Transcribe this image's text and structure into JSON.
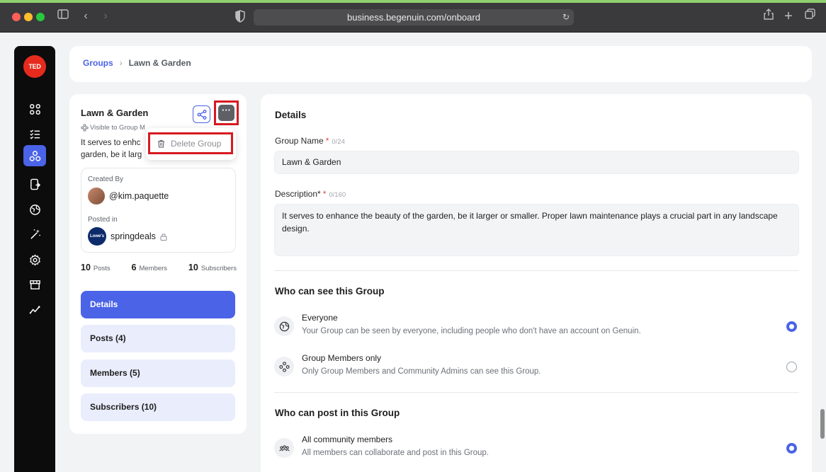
{
  "browser": {
    "url": "business.begenuin.com/onboard"
  },
  "sidebar": {
    "logo_text": "TED",
    "items": [
      {
        "icon": "grid-icon"
      },
      {
        "icon": "checklist-icon"
      },
      {
        "icon": "groups-icon",
        "active": true
      },
      {
        "icon": "mobile-share-icon"
      },
      {
        "icon": "globe-icon"
      },
      {
        "icon": "magic-wand-icon"
      },
      {
        "icon": "settings-icon"
      },
      {
        "icon": "store-icon"
      },
      {
        "icon": "analytics-icon"
      }
    ]
  },
  "breadcrumb": {
    "root": "Groups",
    "separator": "›",
    "current": "Lawn & Garden"
  },
  "group_card": {
    "title": "Lawn & Garden",
    "visibility_text": "Visible to Group M",
    "description_line1": "It serves to enhc",
    "description_line2": "garden, be it larg",
    "menu": {
      "delete_label": "Delete Group"
    },
    "created_by_label": "Created By",
    "creator": "@kim.paquette",
    "posted_in_label": "Posted in",
    "community": "springdeals",
    "brand_logo_text": "Lowe's",
    "stats": {
      "posts_count": "10",
      "posts_label": "Posts",
      "members_count": "6",
      "members_label": "Members",
      "subscribers_count": "10",
      "subscribers_label": "Subscribers"
    },
    "nav": {
      "details": "Details",
      "posts": "Posts (4)",
      "members": "Members (5)",
      "subscribers": "Subscribers (10)"
    }
  },
  "details": {
    "section_title": "Details",
    "group_name_label": "Group Name",
    "group_name_required": "*",
    "group_name_counter": "0/24",
    "group_name_value": "Lawn & Garden",
    "description_label": "Description*",
    "description_required": "*",
    "description_counter": "0/160",
    "description_value": "It serves to enhance the beauty of the garden, be it larger or smaller. Proper lawn maintenance plays a crucial part in any landscape design."
  },
  "visibility": {
    "section_title": "Who can see this Group",
    "options": [
      {
        "title": "Everyone",
        "description": "Your Group can be seen by everyone, including people who don't have an account on Genuin.",
        "selected": true
      },
      {
        "title": "Group Members only",
        "description": "Only Group Members and Community Admins can see this Group.",
        "selected": false
      }
    ]
  },
  "posting": {
    "section_title": "Who can post in this Group",
    "options": [
      {
        "title": "All community members",
        "description": "All members can collaborate and post in this Group.",
        "selected": true
      }
    ]
  },
  "colors": {
    "accent": "#4a63e7",
    "highlight_red": "#d71920"
  }
}
